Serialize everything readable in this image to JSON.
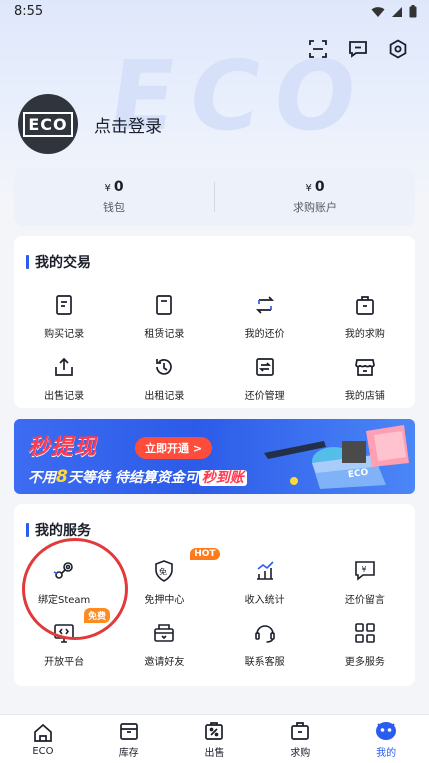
{
  "status_bar": {
    "time": "8:55"
  },
  "background_word": "ECO",
  "profile": {
    "avatar_text": "ECO",
    "login_text": "点击登录"
  },
  "wallet": {
    "currency": "¥",
    "items": [
      {
        "value": "0",
        "label": "钱包"
      },
      {
        "value": "0",
        "label": "求购账户"
      }
    ]
  },
  "my_trades": {
    "title": "我的交易",
    "items": [
      {
        "label": "购买记录",
        "icon": "purchase-record-icon"
      },
      {
        "label": "租赁记录",
        "icon": "rental-record-icon"
      },
      {
        "label": "我的还价",
        "icon": "my-counteroffer-icon"
      },
      {
        "label": "我的求购",
        "icon": "my-wanted-icon"
      },
      {
        "label": "出售记录",
        "icon": "sale-record-icon"
      },
      {
        "label": "出租记录",
        "icon": "lease-record-icon"
      },
      {
        "label": "还价管理",
        "icon": "counteroffer-manage-icon"
      },
      {
        "label": "我的店铺",
        "icon": "my-shop-icon"
      }
    ]
  },
  "banner": {
    "headline": "秒提现",
    "button": "立即开通 >",
    "line_prefix": "不用",
    "line_days": "8",
    "line_middle": "天等待 待结算资金可",
    "line_highlight": "秒到账",
    "box_text": "ECO"
  },
  "my_services": {
    "title": "我的服务",
    "items": [
      {
        "label": "绑定Steam",
        "icon": "steam-icon"
      },
      {
        "label": "免押中心",
        "icon": "deposit-free-icon",
        "badge": "HOT"
      },
      {
        "label": "收入统计",
        "icon": "income-stats-icon"
      },
      {
        "label": "还价留言",
        "icon": "counteroffer-message-icon"
      },
      {
        "label": "开放平台",
        "icon": "open-platform-icon",
        "badge": "免费"
      },
      {
        "label": "邀请好友",
        "icon": "invite-friends-icon"
      },
      {
        "label": "联系客服",
        "icon": "customer-service-icon"
      },
      {
        "label": "更多服务",
        "icon": "more-services-icon"
      }
    ]
  },
  "tabbar": [
    {
      "label": "ECO",
      "icon": "home-icon"
    },
    {
      "label": "库存",
      "icon": "inventory-icon"
    },
    {
      "label": "出售",
      "icon": "sell-icon"
    },
    {
      "label": "求购",
      "icon": "wanted-icon"
    },
    {
      "label": "我的",
      "icon": "mine-icon",
      "active": true
    }
  ],
  "colors": {
    "accent": "#2b5cf0",
    "hot_badge": "#ff7a1a",
    "free_badge": "#ff8a1f",
    "annotation": "#e23a3a"
  }
}
